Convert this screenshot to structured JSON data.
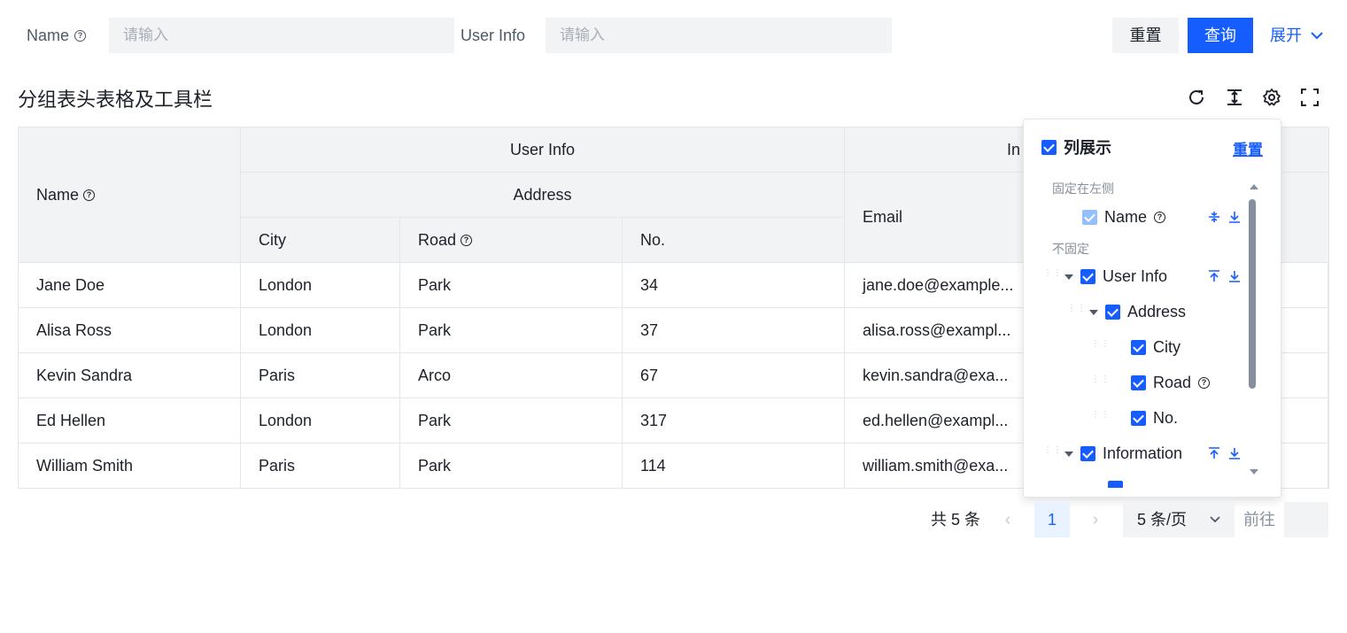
{
  "search": {
    "name_label": "Name",
    "name_placeholder": "请输入",
    "userinfo_label": "User Info",
    "userinfo_placeholder": "请输入",
    "reset": "重置",
    "query": "查询",
    "expand": "展开"
  },
  "title": "分组表头表格及工具栏",
  "icons": [
    "refresh-icon",
    "density-icon",
    "settings-icon",
    "fullscreen-icon"
  ],
  "accent": "#165dff",
  "table": {
    "headers": {
      "name": "Name",
      "user_info": "User Info",
      "address": "Address",
      "city": "City",
      "road": "Road",
      "no": "No.",
      "information_partial": "In",
      "email": "Email"
    },
    "rows": [
      {
        "name": "Jane Doe",
        "city": "London",
        "road": "Park",
        "no": "34",
        "email": "jane.doe@example..."
      },
      {
        "name": "Alisa Ross",
        "city": "London",
        "road": "Park",
        "no": "37",
        "email": "alisa.ross@exampl..."
      },
      {
        "name": "Kevin Sandra",
        "city": "Paris",
        "road": "Arco",
        "no": "67",
        "email": "kevin.sandra@exa..."
      },
      {
        "name": "Ed Hellen",
        "city": "London",
        "road": "Park",
        "no": "317",
        "email": "ed.hellen@exampl..."
      },
      {
        "name": "William Smith",
        "city": "Paris",
        "road": "Park",
        "no": "114",
        "email": "william.smith@exa..."
      }
    ]
  },
  "column_panel": {
    "title": "列展示",
    "reset": "重置",
    "group_fixed_left": "固定在左侧",
    "group_unfixed": "不固定",
    "items": {
      "name": "Name",
      "user_info": "User Info",
      "address": "Address",
      "city": "City",
      "road": "Road",
      "no": "No.",
      "information": "Information"
    }
  },
  "pagination": {
    "total": "共 5 条",
    "current": "1",
    "page_size": "5 条/页",
    "goto": "前往"
  }
}
